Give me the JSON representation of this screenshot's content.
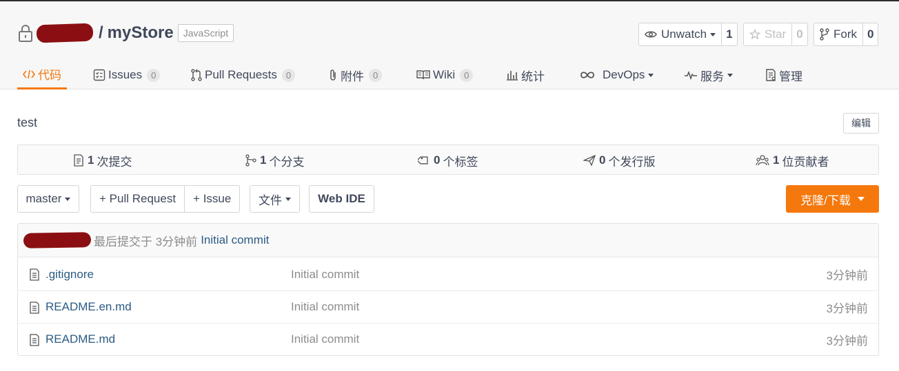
{
  "repo": {
    "separator": "/",
    "name": "myStore",
    "language": "JavaScript"
  },
  "social": {
    "watch_label": "Unwatch",
    "watch_count": "1",
    "star_label": "Star",
    "star_count": "0",
    "fork_label": "Fork",
    "fork_count": "0"
  },
  "tabs": {
    "code": "代码",
    "issues": "Issues",
    "issues_count": "0",
    "pull_requests": "Pull Requests",
    "pull_requests_count": "0",
    "attachments": "附件",
    "attachments_count": "0",
    "wiki": "Wiki",
    "wiki_count": "0",
    "stats": "统计",
    "devops": "DevOps",
    "services": "服务",
    "manage": "管理"
  },
  "description": "test",
  "edit_label": "编辑",
  "stats": {
    "commits_num": "1",
    "commits_label": "次提交",
    "branches_num": "1",
    "branches_label": "个分支",
    "tags_num": "0",
    "tags_label": "个标签",
    "releases_num": "0",
    "releases_label": "个发行版",
    "contributors_num": "1",
    "contributors_label": "位贡献者"
  },
  "toolbar": {
    "branch": "master",
    "pull_request": "+ Pull Request",
    "issue": "+ Issue",
    "file": "文件",
    "web_ide": "Web IDE",
    "clone": "克隆/下载"
  },
  "last_commit": {
    "meta": "最后提交于 3分钟前",
    "message": "Initial commit"
  },
  "files": [
    {
      "name": ".gitignore",
      "message": "Initial commit",
      "time": "3分钟前"
    },
    {
      "name": "README.en.md",
      "message": "Initial commit",
      "time": "3分钟前"
    },
    {
      "name": "README.md",
      "message": "Initial commit",
      "time": "3分钟前"
    }
  ],
  "colors": {
    "accent": "#f5780c",
    "link": "#2b5b84",
    "text": "#40485b",
    "muted": "#8c8c8c"
  }
}
